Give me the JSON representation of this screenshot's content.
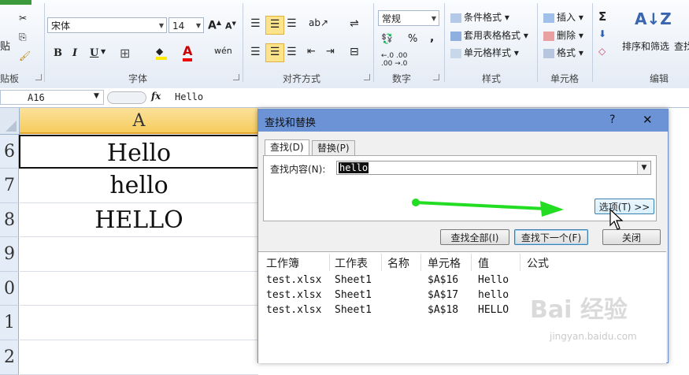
{
  "ribbon": {
    "clipboard": {
      "paste": "贴",
      "label": "贴板"
    },
    "font": {
      "name": "宋体",
      "size": "14",
      "label": "字体",
      "bold": "B",
      "italic": "I",
      "underline": "U",
      "grow": "A",
      "shrink": "A",
      "phonetic": "wén"
    },
    "align": {
      "label": "对齐方式"
    },
    "number": {
      "format": "常规",
      "percent": "%",
      "comma": ",",
      "label": "数字",
      "inc": "←.0 .00",
      "dec": ".00 →.0"
    },
    "styles": {
      "conditional": "条件格式",
      "table": "套用表格格式",
      "cell": "单元格样式",
      "label": "样式"
    },
    "cells": {
      "insert": "插入",
      "delete": "删除",
      "format": "格式",
      "label": "单元格"
    },
    "editing": {
      "sigma": "Σ",
      "sort": "排序和筛选",
      "find": "查找",
      "label": "编辑"
    }
  },
  "formula_bar": {
    "name_box": "A16",
    "fx": "fx",
    "value": "Hello"
  },
  "grid": {
    "column_header": "A",
    "rows": [
      {
        "num": "6",
        "value": "Hello"
      },
      {
        "num": "7",
        "value": "hello"
      },
      {
        "num": "8",
        "value": "HELLO"
      },
      {
        "num": "9",
        "value": ""
      },
      {
        "num": "0",
        "value": ""
      },
      {
        "num": "1",
        "value": ""
      },
      {
        "num": "2",
        "value": ""
      }
    ]
  },
  "dialog": {
    "title": "查找和替换",
    "help": "?",
    "close": "✕",
    "tabs": [
      "查找(D)",
      "替换(P)"
    ],
    "find_label": "查找内容(N):",
    "find_value": "hello",
    "options_button": "选项(T) >>",
    "find_all": "查找全部(I)",
    "find_next": "查找下一个(F)",
    "close_button": "关闭",
    "results": {
      "headers": [
        "工作簿",
        "工作表",
        "名称",
        "单元格",
        "值",
        "公式"
      ],
      "rows": [
        [
          "test.xlsx",
          "Sheet1",
          "",
          "$A$16",
          "Hello",
          ""
        ],
        [
          "test.xlsx",
          "Sheet1",
          "",
          "$A$17",
          "hello",
          ""
        ],
        [
          "test.xlsx",
          "Sheet1",
          "",
          "$A$18",
          "HELLO",
          ""
        ]
      ]
    }
  },
  "watermark": {
    "brand": "Bai 经验",
    "url": "jingyan.baidu.com"
  },
  "colors": {
    "accent": "#6b93d6",
    "arrow": "#22dd22",
    "selected_header": "#f8d778"
  }
}
